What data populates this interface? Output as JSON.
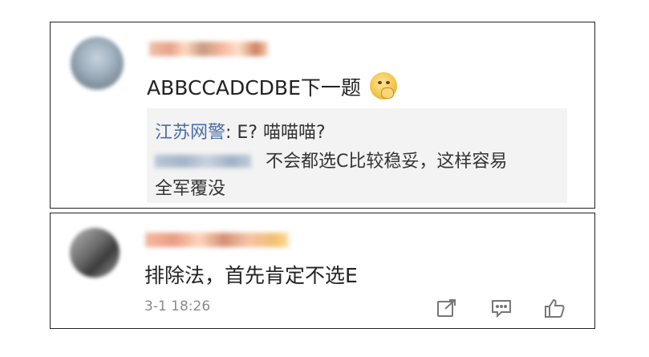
{
  "comments": [
    {
      "text": "ABBCCADCDBE下一题",
      "reply_author": "江苏网警",
      "reply_text": ": E? 喵喵喵?",
      "reply2_text": "不会都选C比较稳妥，这样容易",
      "reply3_text": "全军覆没"
    },
    {
      "text": "排除法，首先肯定不选E",
      "time": "3-1 18:26"
    }
  ],
  "icons": [
    "avatar",
    "emoji-icon",
    "share-icon",
    "comment-icon",
    "like-icon"
  ],
  "colors": {
    "reply_author": "#4a6fa5",
    "text": "#222222",
    "meta": "#8a8a8a"
  }
}
